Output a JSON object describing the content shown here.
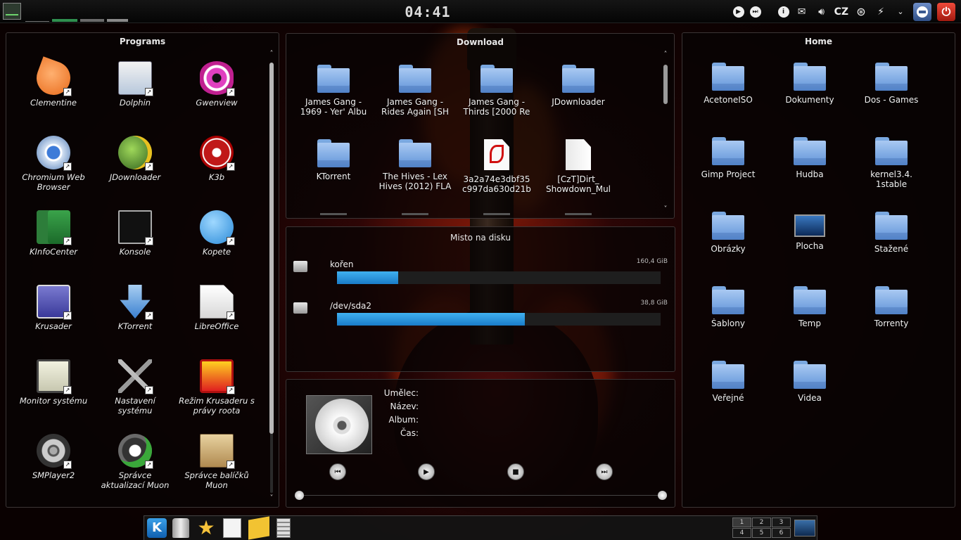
{
  "top_panel": {
    "clock": "04:41",
    "language": "CZ",
    "graph_colors": [
      "#6a6a6a",
      "#2f8f4f",
      "#7a7a7a",
      "#8a8a8a"
    ]
  },
  "programs": {
    "title": "Programs",
    "items": [
      {
        "label": "Clementine",
        "icon": "clementine-icon"
      },
      {
        "label": "Dolphin",
        "icon": "dolphin-icon"
      },
      {
        "label": "Gwenview",
        "icon": "gwenview-icon"
      },
      {
        "label": "Chromium Web Browser",
        "icon": "chromium-icon"
      },
      {
        "label": "JDownloader",
        "icon": "jdownloader-icon"
      },
      {
        "label": "K3b",
        "icon": "k3b-icon"
      },
      {
        "label": "KInfoCenter",
        "icon": "kinfocenter-icon"
      },
      {
        "label": "Konsole",
        "icon": "konsole-icon"
      },
      {
        "label": "Kopete",
        "icon": "kopete-icon"
      },
      {
        "label": "Krusader",
        "icon": "krusader-icon"
      },
      {
        "label": "KTorrent",
        "icon": "ktorrent-icon"
      },
      {
        "label": "LibreOffice",
        "icon": "libreoffice-icon"
      },
      {
        "label": "Monitor systému",
        "icon": "system-monitor-icon"
      },
      {
        "label": "Nastavení systému",
        "icon": "system-settings-icon"
      },
      {
        "label": "Režim Krusaderu s právy roota",
        "icon": "krusader-root-icon"
      },
      {
        "label": "SMPlayer2",
        "icon": "smplayer-icon"
      },
      {
        "label": "Správce aktualizací Muon",
        "icon": "muon-updater-icon"
      },
      {
        "label": "Správce balíčků Muon",
        "icon": "muon-package-icon"
      }
    ]
  },
  "download": {
    "title": "Download",
    "items": [
      {
        "label": "James Gang - 1969 - Yer' Albu",
        "type": "folder"
      },
      {
        "label": "James Gang - Rides Again [SH",
        "type": "folder"
      },
      {
        "label": "James Gang - Thirds [2000 Re",
        "type": "folder"
      },
      {
        "label": "JDownloader",
        "type": "folder"
      },
      {
        "label": "KTorrent",
        "type": "folder"
      },
      {
        "label": "The Hives - Lex Hives (2012) FLA",
        "type": "folder"
      },
      {
        "label": "3a2a74e3dbf35 c997da630d21b",
        "type": "pdf"
      },
      {
        "label": "[CzT]Dirt_ Showdown_Mul",
        "type": "file"
      }
    ]
  },
  "disk": {
    "title": "Misto na disku",
    "items": [
      {
        "name": "kořen",
        "size": "160,4 GiB",
        "used_fraction": 0.19
      },
      {
        "name": "/dev/sda2",
        "size": "38,8 GiB",
        "used_fraction": 0.58
      }
    ]
  },
  "player": {
    "labels": [
      "Umělec:",
      "Název:",
      "Album:",
      "Čas:"
    ]
  },
  "home": {
    "title": "Home",
    "items": [
      {
        "label": "AcetoneISO",
        "type": "folder"
      },
      {
        "label": "Dokumenty",
        "type": "folder"
      },
      {
        "label": "Dos - Games",
        "type": "folder"
      },
      {
        "label": "Gimp Project",
        "type": "folder"
      },
      {
        "label": "Hudba",
        "type": "folder"
      },
      {
        "label": "kernel3.4. 1stable",
        "type": "folder"
      },
      {
        "label": "Obrázky",
        "type": "folder"
      },
      {
        "label": "Plocha",
        "type": "desktop"
      },
      {
        "label": "Stažené",
        "type": "folder"
      },
      {
        "label": "Šablony",
        "type": "folder"
      },
      {
        "label": "Temp",
        "type": "folder"
      },
      {
        "label": "Torrenty",
        "type": "folder"
      },
      {
        "label": "Veřejné",
        "type": "folder"
      },
      {
        "label": "Videa",
        "type": "folder"
      }
    ]
  },
  "dock": {
    "pager": [
      "1",
      "2",
      "3",
      "4",
      "5",
      "6"
    ]
  }
}
